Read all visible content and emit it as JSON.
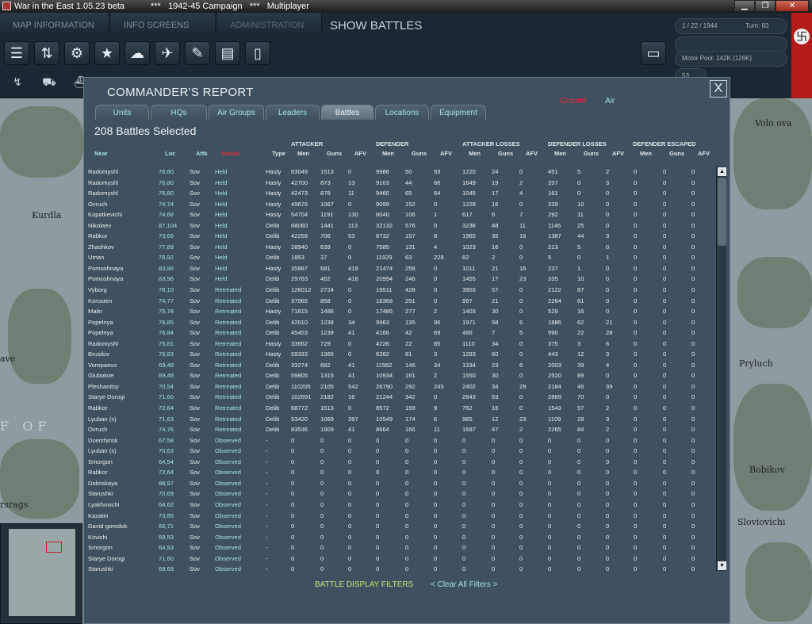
{
  "window": {
    "title": "War in the East 1.05.23 beta",
    "title2": "***   1942-45 Campaign   ***   Multiplayer",
    "min": "▁",
    "max": "❐",
    "close": "✕"
  },
  "topbar": {
    "tabs": [
      "MAP INFORMATION",
      "INFO SCREENS",
      "ADMINISTRATION"
    ],
    "mode": "SHOW BATTLES"
  },
  "rightpanel": {
    "date": "1 / 22 / 1944",
    "turn": "Turn: 83",
    "motor_pool": "Motor Pool:  142K (126K)",
    "num": "53"
  },
  "map_labels": [
    "Kurdla",
    "ave",
    "F OF",
    "rsrags",
    "Volo ova",
    "Pryluch",
    "Sloviovichi",
    "Bobikov"
  ],
  "dialog": {
    "title": "COMMANDER'S REPORT",
    "close": "X",
    "filter_ground": "Ground",
    "filter_air": "Air",
    "tabs": [
      "Units",
      "HQs",
      "Air Groups",
      "Leaders",
      "Battles",
      "Locations",
      "Equipment"
    ],
    "active_tab": "Battles",
    "selected": "208 Battles Selected",
    "groups": [
      "ATTACKER",
      "DEFENDER",
      "ATTACKER LOSSES",
      "DEFENDER LOSSES",
      "DEFENDER ESCAPED"
    ],
    "headers": [
      "Near",
      "Loc",
      "Attk",
      "Result",
      "Type",
      "Men",
      "Guns",
      "AFV",
      "Men",
      "Guns",
      "AFV",
      "Men",
      "Guns",
      "AFV",
      "Men",
      "Guns",
      "AFV",
      "Men",
      "Guns",
      "AFV"
    ],
    "footer_filters": "BATTLE DISPLAY FILTERS",
    "footer_clear": "< Clear All Filters >"
  },
  "rows": [
    [
      "Radomyshl",
      "76,80",
      "Sov",
      "Held",
      "Hasty",
      "63049",
      "1513",
      "0",
      "9986",
      "50",
      "93",
      "1220",
      "24",
      "0",
      "451",
      "5",
      "2",
      "0",
      "0",
      "0"
    ],
    [
      "Radomyshl",
      "76,80",
      "Sov",
      "Held",
      "Hasty",
      "42700",
      "873",
      "13",
      "9103",
      "44",
      "66",
      "1649",
      "19",
      "2",
      "257",
      "0",
      "3",
      "0",
      "0",
      "0"
    ],
    [
      "Radomyshl",
      "76,80",
      "Sov",
      "Held",
      "Hasty",
      "42473",
      "878",
      "11",
      "9460",
      "65",
      "64",
      "1045",
      "17",
      "4",
      "161",
      "0",
      "0",
      "0",
      "0",
      "0"
    ],
    [
      "Ovruch",
      "74,74",
      "Sov",
      "Held",
      "Hasty",
      "49676",
      "1067",
      "0",
      "9099",
      "152",
      "0",
      "1228",
      "16",
      "0",
      "339",
      "10",
      "0",
      "0",
      "0",
      "0"
    ],
    [
      "Kopatkevichi",
      "74,68",
      "Sov",
      "Held",
      "Hasty",
      "54704",
      "1191",
      "130",
      "8040",
      "106",
      "1",
      "617",
      "6",
      "7",
      "292",
      "11",
      "0",
      "0",
      "0",
      "0"
    ],
    [
      "Nikolaev",
      "87,104",
      "Sov",
      "Held",
      "Delib",
      "68060",
      "1441",
      "113",
      "32132",
      "576",
      "0",
      "3238",
      "48",
      "11",
      "1146",
      "25",
      "0",
      "0",
      "0",
      "0"
    ],
    [
      "Rabkor",
      "73,66",
      "Sov",
      "Held",
      "Delib",
      "42258",
      "706",
      "53",
      "8732",
      "157",
      "8",
      "1965",
      "35",
      "16",
      "1387",
      "44",
      "3",
      "0",
      "0",
      "0"
    ],
    [
      "Zhashkov",
      "77,89",
      "Sov",
      "Held",
      "Hasty",
      "28940",
      "639",
      "0",
      "7585",
      "131",
      "4",
      "1023",
      "16",
      "0",
      "213",
      "5",
      "0",
      "0",
      "0",
      "0"
    ],
    [
      "Uman",
      "78,92",
      "Sov",
      "Held",
      "Delib",
      "1853",
      "37",
      "0",
      "11929",
      "63",
      "228",
      "82",
      "2",
      "0",
      "5",
      "0",
      "1",
      "0",
      "0",
      "0"
    ],
    [
      "Pomoshnaya",
      "83,96",
      "Sov",
      "Held",
      "Hasty",
      "35887",
      "681",
      "419",
      "21474",
      "258",
      "0",
      "1011",
      "21",
      "16",
      "237",
      "1",
      "0",
      "0",
      "0",
      "0"
    ],
    [
      "Pomoshnaya",
      "83,96",
      "Sov",
      "Held",
      "Delib",
      "29763",
      "462",
      "418",
      "20994",
      "246",
      "0",
      "1455",
      "17",
      "23",
      "335",
      "10",
      "0",
      "0",
      "0",
      "0"
    ],
    [
      "Vyborg",
      "78,10",
      "Sov",
      "Retreated",
      "Delib",
      "126012",
      "2724",
      "0",
      "19511",
      "428",
      "0",
      "3903",
      "57",
      "0",
      "2122",
      "87",
      "0",
      "0",
      "0",
      "0"
    ],
    [
      "Korosten",
      "74,77",
      "Sov",
      "Retreated",
      "Delib",
      "37065",
      "858",
      "0",
      "18368",
      "251",
      "0",
      "997",
      "21",
      "0",
      "2264",
      "61",
      "0",
      "0",
      "0",
      "0"
    ],
    [
      "Malin",
      "75,78",
      "Sov",
      "Retreated",
      "Hasty",
      "71815",
      "1486",
      "0",
      "17486",
      "277",
      "2",
      "1403",
      "30",
      "0",
      "529",
      "16",
      "0",
      "0",
      "0",
      "0"
    ],
    [
      "Popelnya",
      "76,85",
      "Sov",
      "Retreated",
      "Delib",
      "42010",
      "1238",
      "34",
      "9963",
      "135",
      "96",
      "1971",
      "58",
      "6",
      "1886",
      "62",
      "21",
      "0",
      "0",
      "0"
    ],
    [
      "Popelnya",
      "76,84",
      "Sov",
      "Retreated",
      "Delib",
      "45453",
      "1239",
      "41",
      "4166",
      "42",
      "69",
      "486",
      "7",
      "5",
      "990",
      "22",
      "28",
      "0",
      "0",
      "0"
    ],
    [
      "Radomyshl",
      "75,81",
      "Sov",
      "Retreated",
      "Hasty",
      "33662",
      "729",
      "0",
      "4226",
      "22",
      "85",
      "1110",
      "34",
      "0",
      "375",
      "3",
      "6",
      "0",
      "0",
      "0"
    ],
    [
      "Brusilov",
      "76,83",
      "Sov",
      "Retreated",
      "Hasty",
      "59333",
      "1365",
      "0",
      "6262",
      "81",
      "3",
      "1293",
      "60",
      "0",
      "443",
      "12",
      "3",
      "0",
      "0",
      "0"
    ],
    [
      "Voropaevo",
      "69,48",
      "Sov",
      "Retreated",
      "Delib",
      "33274",
      "682",
      "41",
      "11562",
      "146",
      "34",
      "1334",
      "23",
      "6",
      "2003",
      "39",
      "4",
      "0",
      "0",
      "0"
    ],
    [
      "Glubokoe",
      "69,49",
      "Sov",
      "Retreated",
      "Delib",
      "59805",
      "1315",
      "41",
      "10934",
      "161",
      "2",
      "1550",
      "30",
      "0",
      "2520",
      "89",
      "0",
      "0",
      "0",
      "0"
    ],
    [
      "Pleshanitsy",
      "70,54",
      "Sov",
      "Retreated",
      "Delib",
      "110205",
      "2105",
      "542",
      "26790",
      "292",
      "245",
      "2402",
      "34",
      "29",
      "2184",
      "46",
      "39",
      "0",
      "0",
      "0"
    ],
    [
      "Starye Dorogi",
      "71,60",
      "Sov",
      "Retreated",
      "Delib",
      "102691",
      "2182",
      "16",
      "21244",
      "342",
      "0",
      "2843",
      "53",
      "0",
      "2869",
      "70",
      "0",
      "0",
      "0",
      "0"
    ],
    [
      "Rabkor",
      "72,64",
      "Sov",
      "Retreated",
      "Delib",
      "68772",
      "1513",
      "0",
      "8572",
      "159",
      "9",
      "752",
      "16",
      "0",
      "1543",
      "57",
      "2",
      "0",
      "0",
      "0"
    ],
    [
      "Lyuban (s)",
      "71,63",
      "Sov",
      "Retreated",
      "Delib",
      "53420",
      "1069",
      "397",
      "10549",
      "174",
      "6",
      "985",
      "12",
      "23",
      "1109",
      "28",
      "3",
      "0",
      "0",
      "0"
    ],
    [
      "Ovruch",
      "74,76",
      "Sov",
      "Retreated",
      "Delib",
      "83536",
      "1909",
      "41",
      "8664",
      "166",
      "11",
      "1687",
      "47",
      "2",
      "2265",
      "84",
      "2",
      "0",
      "0",
      "0"
    ],
    [
      "Dzerzhinsk",
      "67,58",
      "Sov",
      "Observed",
      "-",
      "0",
      "0",
      "0",
      "0",
      "0",
      "0",
      "0",
      "0",
      "0",
      "0",
      "0",
      "0",
      "0",
      "0",
      "0"
    ],
    [
      "Lyuban (s)",
      "70,63",
      "Sov",
      "Observed",
      "-",
      "0",
      "0",
      "0",
      "0",
      "0",
      "0",
      "0",
      "0",
      "0",
      "0",
      "0",
      "0",
      "0",
      "0",
      "0"
    ],
    [
      "Smorgon",
      "64,54",
      "Sov",
      "Observed",
      "-",
      "0",
      "0",
      "0",
      "0",
      "0",
      "0",
      "0",
      "0",
      "0",
      "0",
      "0",
      "0",
      "0",
      "0",
      "0"
    ],
    [
      "Rabkor",
      "72,64",
      "Sov",
      "Observed",
      "-",
      "0",
      "0",
      "0",
      "0",
      "0",
      "0",
      "0",
      "0",
      "0",
      "0",
      "0",
      "0",
      "0",
      "0",
      "0"
    ],
    [
      "Dolinskaya",
      "88,97",
      "Sov",
      "Observed",
      "-",
      "0",
      "0",
      "0",
      "0",
      "0",
      "0",
      "0",
      "0",
      "0",
      "0",
      "0",
      "0",
      "0",
      "0",
      "0"
    ],
    [
      "Starushki",
      "70,69",
      "Sov",
      "Observed",
      "-",
      "0",
      "0",
      "0",
      "0",
      "0",
      "0",
      "0",
      "0",
      "0",
      "0",
      "0",
      "0",
      "0",
      "0",
      "0"
    ],
    [
      "Lyakhovichi",
      "64,62",
      "Sov",
      "Observed",
      "-",
      "0",
      "0",
      "0",
      "0",
      "0",
      "0",
      "0",
      "0",
      "0",
      "0",
      "0",
      "0",
      "0",
      "0",
      "0"
    ],
    [
      "Kazatin",
      "73,85",
      "Sov",
      "Observed",
      "-",
      "0",
      "0",
      "0",
      "0",
      "0",
      "0",
      "0",
      "0",
      "0",
      "0",
      "0",
      "0",
      "0",
      "0",
      "0"
    ],
    [
      "David-gorodok",
      "66,71",
      "Sov",
      "Observed",
      "-",
      "0",
      "0",
      "0",
      "0",
      "0",
      "0",
      "0",
      "0",
      "0",
      "0",
      "0",
      "0",
      "0",
      "0",
      "0"
    ],
    [
      "Krivichi",
      "69,53",
      "Sov",
      "Observed",
      "-",
      "0",
      "0",
      "0",
      "0",
      "0",
      "0",
      "0",
      "0",
      "0",
      "0",
      "0",
      "0",
      "0",
      "0",
      "0"
    ],
    [
      "Smorgon",
      "64,53",
      "Sov",
      "Observed",
      "-",
      "0",
      "0",
      "0",
      "0",
      "0",
      "0",
      "0",
      "0",
      "0",
      "0",
      "0",
      "0",
      "0",
      "0",
      "0"
    ],
    [
      "Starye Dorogi",
      "71,60",
      "Sov",
      "Observed",
      "-",
      "0",
      "0",
      "0",
      "0",
      "0",
      "0",
      "0",
      "0",
      "0",
      "0",
      "0",
      "0",
      "0",
      "0",
      "0"
    ],
    [
      "Starushki",
      "69,69",
      "Sov",
      "Observed",
      "-",
      "0",
      "0",
      "0",
      "0",
      "0",
      "0",
      "0",
      "0",
      "0",
      "0",
      "0",
      "0",
      "0",
      "0",
      "0"
    ]
  ],
  "colors": {
    "accent": "#a5e0e9",
    "result_header": "#e03030",
    "footer_filters": "#c8e47a"
  }
}
